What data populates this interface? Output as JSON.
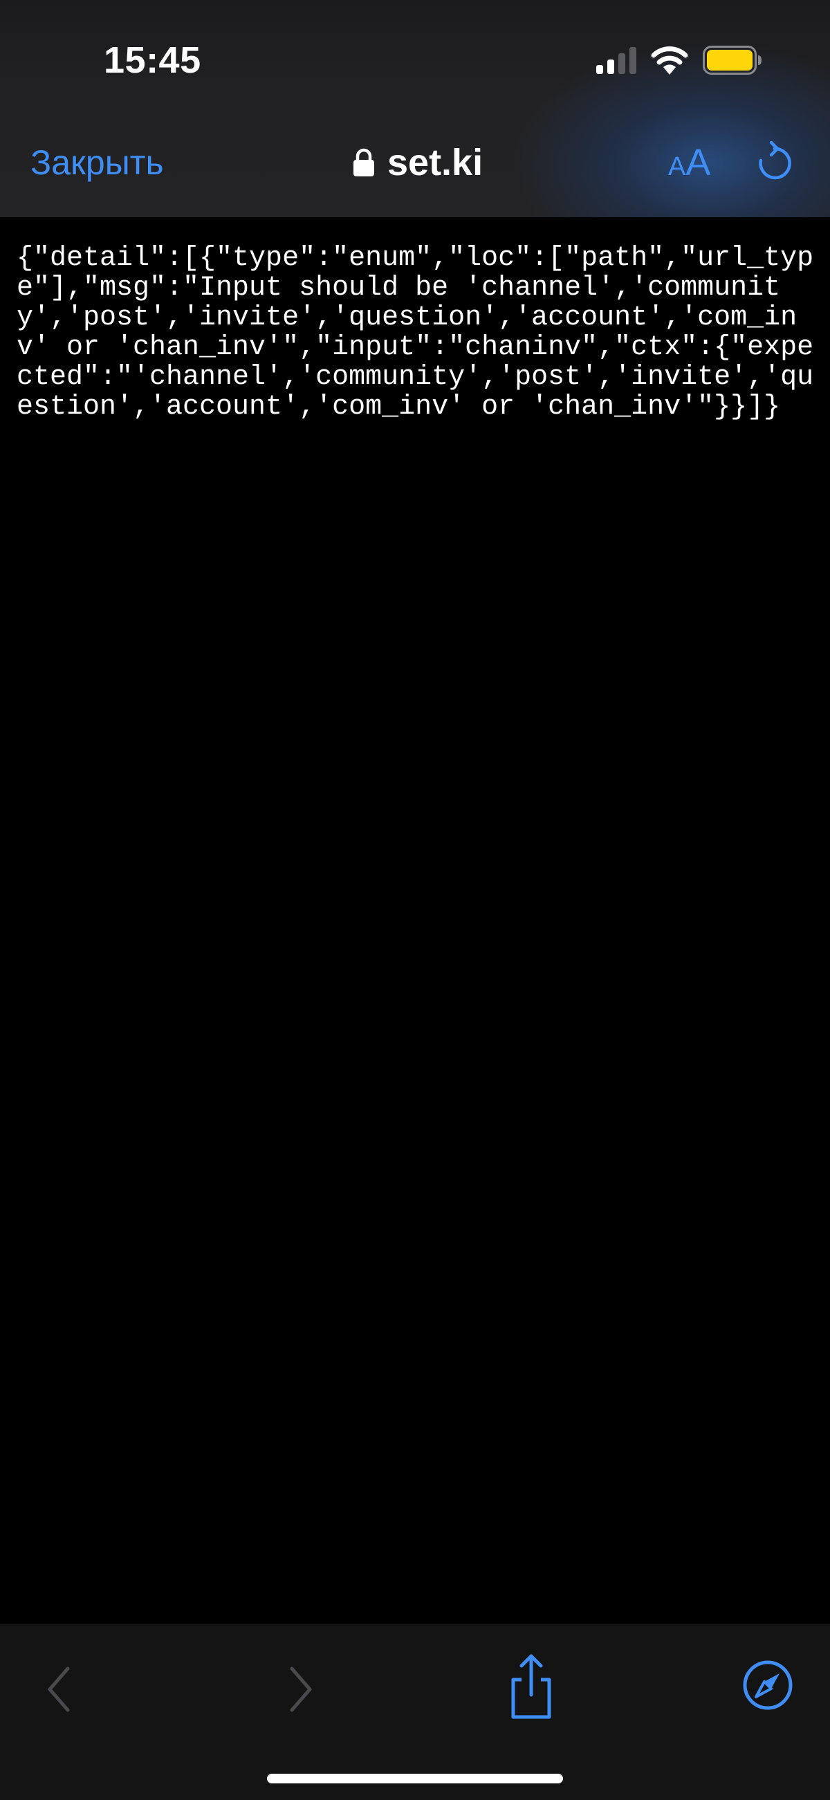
{
  "status_bar": {
    "time": "15:45",
    "icons": [
      "cellular-signal-icon",
      "wifi-icon",
      "battery-icon"
    ],
    "battery_color": "#ffd60a"
  },
  "browser_header": {
    "close_label": "Закрыть",
    "domain": "set.ki",
    "text_size_small": "A",
    "text_size_large": "A",
    "icons": [
      "lock-icon",
      "reload-icon"
    ],
    "accent_color": "#3f8ef5"
  },
  "page": {
    "body_text": "{\"detail\":[{\"type\":\"enum\",\"loc\":[\"path\",\"url_type\"],\"msg\":\"Input should be 'channel','community','post','invite','question','account','com_inv' or 'chan_inv'\",\"input\":\"chaninv\",\"ctx\":{\"expected\":\"'channel','community','post','invite','question','account','com_inv' or 'chan_inv'\"}}]}"
  },
  "toolbar": {
    "icons": [
      "back-arrow-icon",
      "forward-arrow-icon",
      "share-icon",
      "safari-compass-icon"
    ],
    "enabled": {
      "back": false,
      "forward": false,
      "share": true,
      "safari": true
    }
  }
}
